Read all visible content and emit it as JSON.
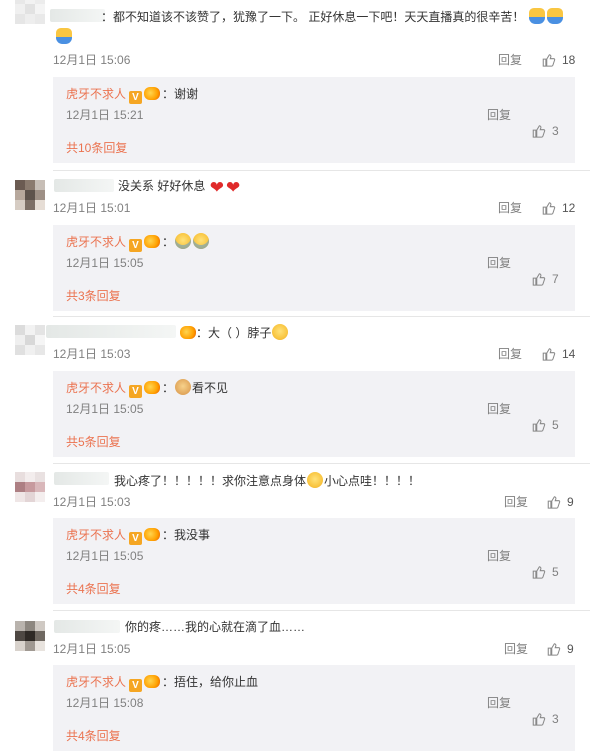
{
  "reply_label": "回复",
  "comments": [
    {
      "text": "：都不知道该不该赞了，犹豫了一下。 正好休息一下吧！天天直播真的很辛苦！",
      "time": "12月1日 15:06",
      "likes": "18",
      "sub": {
        "name": "虎牙不求人",
        "text": "谢谢",
        "time": "12月1日 15:21",
        "likes": "3"
      },
      "more": "共10条回复"
    },
    {
      "text": "没关系 好好休息",
      "time": "12月1日 15:01",
      "likes": "12",
      "sub": {
        "name": "虎牙不求人",
        "text": "",
        "time": "12月1日 15:05",
        "likes": "7"
      },
      "more": "共3条回复"
    },
    {
      "text": "：大（ ）脖子",
      "time": "12月1日 15:03",
      "likes": "14",
      "sub": {
        "name": "虎牙不求人",
        "text": "看不见",
        "time": "12月1日 15:05",
        "likes": "5"
      },
      "more": "共5条回复"
    },
    {
      "text": "我心疼了！！！！！求你注意点身体",
      "text2": "小心点哇！！！！",
      "time": "12月1日 15:03",
      "likes": "9",
      "sub": {
        "name": "虎牙不求人",
        "text": "我没事",
        "time": "12月1日 15:05",
        "likes": "5"
      },
      "more": "共4条回复"
    },
    {
      "text": "你的疼……我的心就在滴了血……",
      "time": "12月1日 15:05",
      "likes": "9",
      "sub": {
        "name": "虎牙不求人",
        "text": "捂住，给你止血",
        "time": "12月1日 15:08",
        "likes": "3"
      },
      "more": "共4条回复"
    }
  ],
  "colors": {
    "accent": "#eb7350",
    "meta": "#808080",
    "subbox": "#f2f2f5"
  },
  "icons": [
    "thumbs-up-icon",
    "verified-v-icon",
    "level-badge-icon",
    "emoji-icon",
    "heart-icon"
  ]
}
